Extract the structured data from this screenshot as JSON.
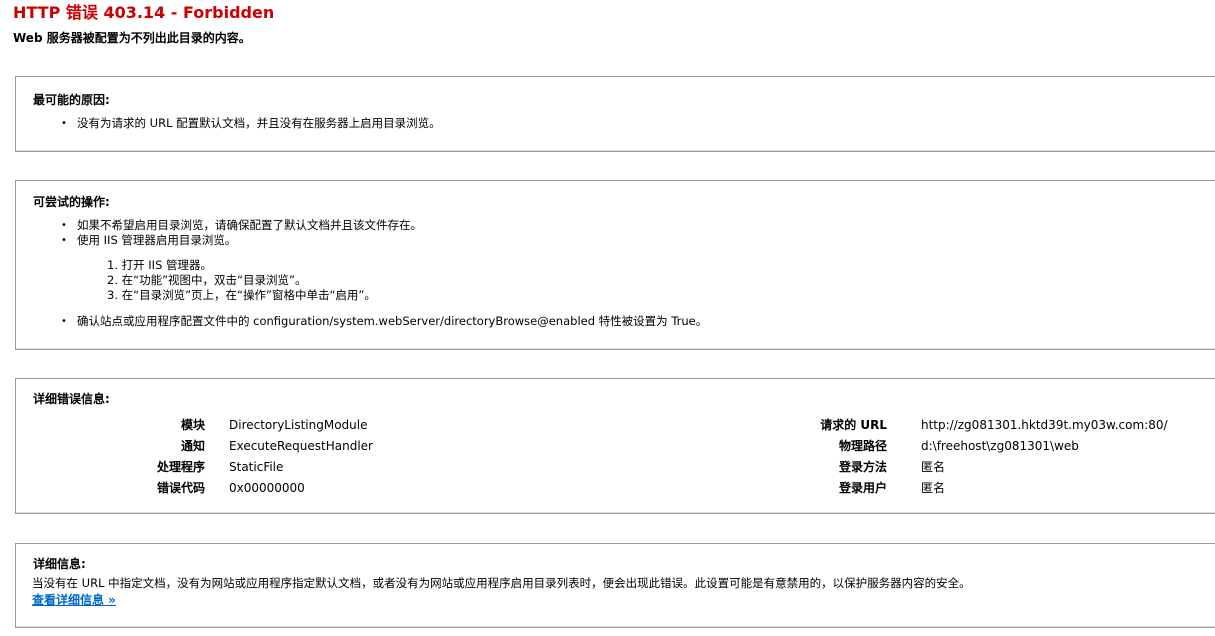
{
  "header": {
    "title": "HTTP 错误 403.14 - Forbidden",
    "subtitle": "Web 服务器被配置为不列出此目录的内容。"
  },
  "causes": {
    "heading": "最可能的原因:",
    "items": [
      "没有为请求的 URL 配置默认文档，并且没有在服务器上启用目录浏览。"
    ]
  },
  "actions": {
    "heading": "可尝试的操作:",
    "item1": "如果不希望启用目录浏览，请确保配置了默认文档并且该文件存在。",
    "item2": "使用 IIS 管理器启用目录浏览。",
    "steps": [
      "1. 打开 IIS 管理器。",
      "2. 在“功能”视图中，双击“目录浏览”。",
      "3. 在“目录浏览”页上，在“操作”窗格中单击“启用”。"
    ],
    "item3": "确认站点或应用程序配置文件中的 configuration/system.webServer/directoryBrowse@enabled 特性被设置为 True。"
  },
  "details": {
    "heading": "详细错误信息:",
    "left": [
      {
        "label": "模块",
        "value": "DirectoryListingModule"
      },
      {
        "label": "通知",
        "value": "ExecuteRequestHandler"
      },
      {
        "label": "处理程序",
        "value": "StaticFile"
      },
      {
        "label": "错误代码",
        "value": "0x00000000"
      }
    ],
    "right": [
      {
        "label": "请求的 URL",
        "value": "http://zg081301.hktd39t.my03w.com:80/"
      },
      {
        "label": "物理路径",
        "value": "d:\\freehost\\zg081301\\web"
      },
      {
        "label": "登录方法",
        "value": "匿名"
      },
      {
        "label": "登录用户",
        "value": "匿名"
      }
    ]
  },
  "more_info": {
    "heading": "详细信息:",
    "text": "当没有在 URL 中指定文档，没有为网站或应用程序指定默认文档，或者没有为网站或应用程序启用目录列表时，便会出现此错误。此设置可能是有意禁用的，以保护服务器内容的安全。",
    "link": "查看详细信息 »"
  }
}
